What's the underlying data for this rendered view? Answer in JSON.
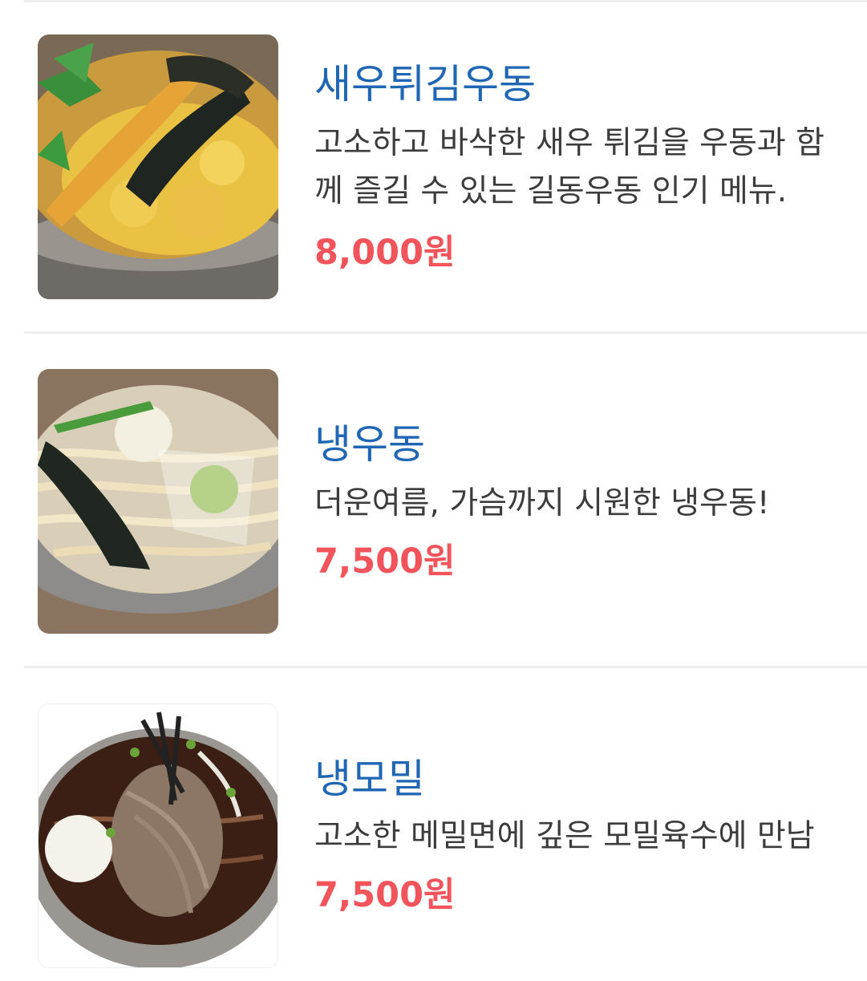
{
  "theme": {
    "name_color": "#1f67b5",
    "price_color": "#f2545b"
  },
  "menu": {
    "items": [
      {
        "name": "새우튀김우동",
        "description": "고소하고 바삭한 새우 튀김을 우동과 함께 즐길 수 있는 길동우동 인기 메뉴.",
        "price": "8,000원",
        "image_icon": "shrimp-tempura-udon-photo"
      },
      {
        "name": "냉우동",
        "description": "더운여름, 가슴까지 시원한 냉우동!",
        "price": "7,500원",
        "image_icon": "cold-udon-photo"
      },
      {
        "name": "냉모밀",
        "description": "고소한 메밀면에 깊은 모밀육수에 만남",
        "price": "7,500원",
        "image_icon": "cold-soba-photo"
      }
    ]
  }
}
